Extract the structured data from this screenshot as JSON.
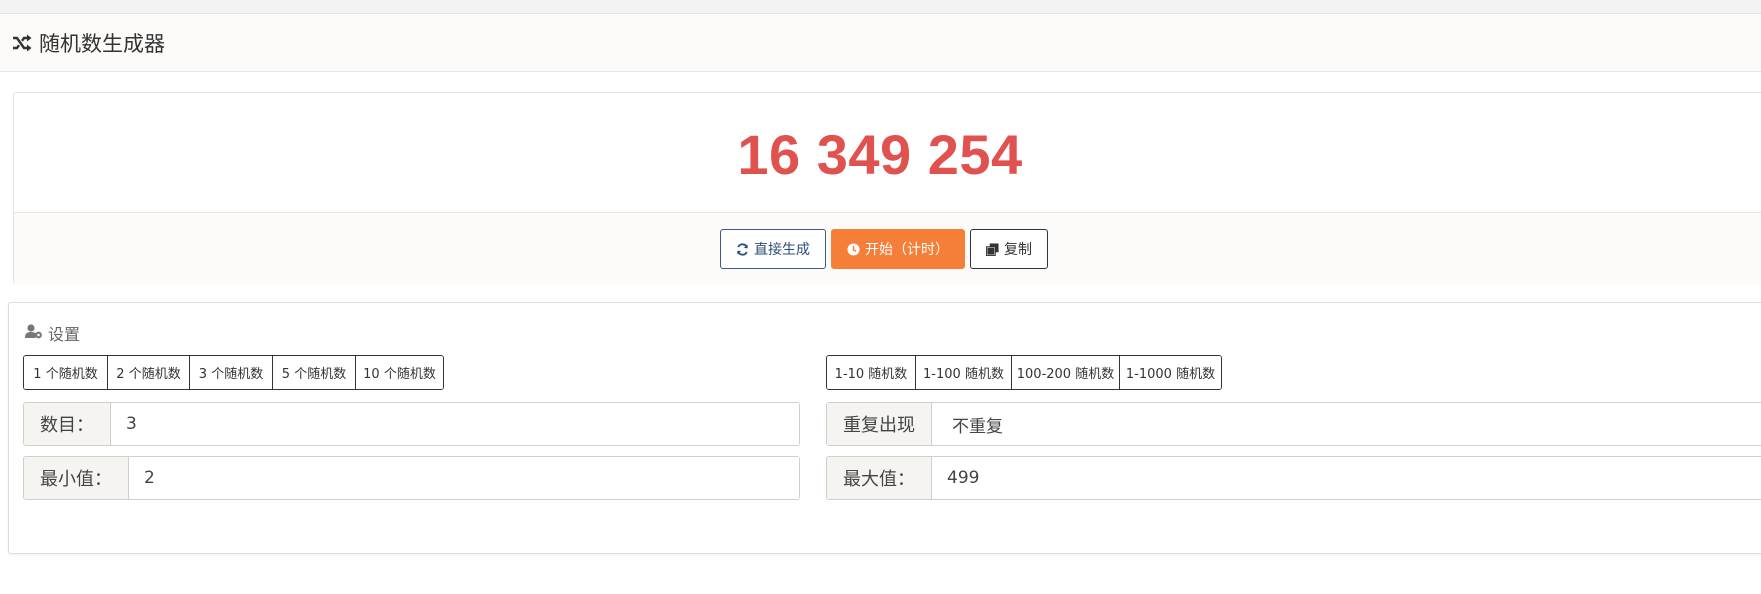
{
  "app": {
    "title": "随机数生成器"
  },
  "result": {
    "value": "16 349 254"
  },
  "actions": {
    "generate": "直接生成",
    "start": "开始（计时）",
    "copy": "复制"
  },
  "settings": {
    "heading": "设置",
    "count_presets": [
      "1 个随机数",
      "2 个随机数",
      "3 个随机数",
      "5 个随机数",
      "10 个随机数"
    ],
    "range_presets": [
      "1-10 随机数",
      "1-100 随机数",
      "100-200 随机数",
      "1-1000 随机数"
    ],
    "count": {
      "label": "数目：",
      "value": "3"
    },
    "repeat": {
      "label": "重复出现",
      "value": "不重复"
    },
    "min": {
      "label": "最小值：",
      "value": "2"
    },
    "max": {
      "label": "最大值：",
      "value": "499"
    }
  },
  "colors": {
    "result": "#e05250",
    "start_button": "#f57f38",
    "generate_button_border": "#3a5b8a"
  }
}
